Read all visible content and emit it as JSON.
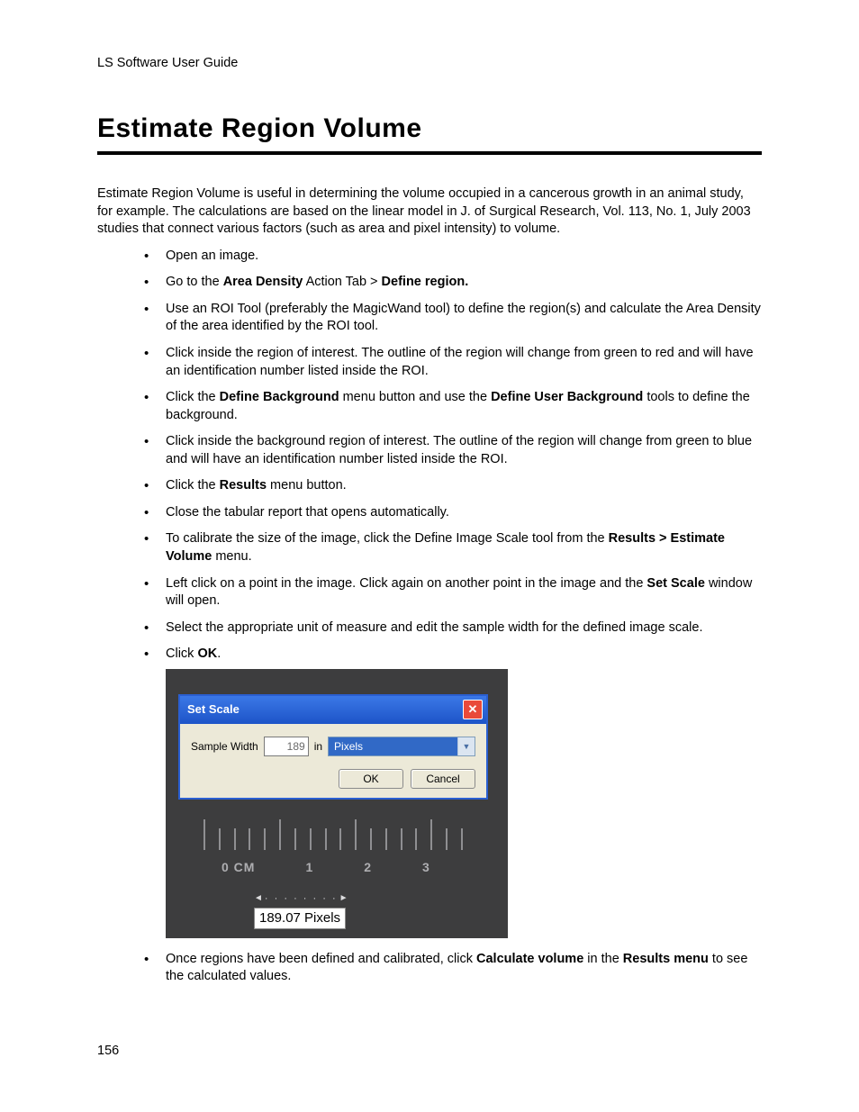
{
  "doc_header": "LS Software User Guide",
  "title": "Estimate Region Volume",
  "intro": "Estimate Region Volume is useful in determining the volume occupied in a cancerous growth in an animal study, for example.  The calculations are based on the linear model in J. of Surgical Research, Vol. 113, No. 1, July 2003 studies that connect various factors (such as area and pixel intensity) to volume.",
  "steps": {
    "s1": "Open an image.",
    "s2a": "Go to the ",
    "s2b": "Area Density",
    "s2c": " Action Tab > ",
    "s2d": "Define region.",
    "s3": "Use an ROI Tool (preferably the MagicWand tool)  to define the region(s) and calculate the Area Density of the area identified by the ROI tool.",
    "s4": "Click inside the region of interest. The outline of the region will change from green to red and will have an identification number listed inside the ROI.",
    "s5a": "Click the ",
    "s5b": "Define Background",
    "s5c": " menu button and use the ",
    "s5d": "Define User Background",
    "s5e": " tools to define the background.",
    "s6": "Click inside the background region of interest. The outline of the region will change from green to blue and will have an identification number listed inside the ROI.",
    "s7a": "Click the ",
    "s7b": "Results",
    "s7c": " menu button.",
    "s8": "Close the tabular report that opens automatically.",
    "s9a": "To calibrate the size of the image, click the Define Image Scale tool from the ",
    "s9b": "Results > Estimate Volume",
    "s9c": " menu.",
    "s10a": "Left click on a point in the image. Click again on another point in the image and the ",
    "s10b": "Set Scale",
    "s10c": " window will open.",
    "s11": "Select the appropriate unit of measure and edit the sample width for the defined image scale.",
    "s12a": "Click ",
    "s12b": "OK",
    "s12c": ".",
    "s13a": "Once regions have been defined and calibrated, click ",
    "s13b": "Calculate volume",
    "s13c": " in the ",
    "s13d": "Results menu",
    "s13e": " to see the calculated values."
  },
  "dialog": {
    "title": "Set Scale",
    "close_glyph": "✕",
    "sample_width_label": "Sample Width",
    "sample_width_value": "189",
    "in_label": "in",
    "unit_selected": "Pixels",
    "ok": "OK",
    "cancel": "Cancel"
  },
  "ruler": {
    "labels": [
      "0 CM",
      "1",
      "2",
      "3"
    ],
    "readout": "189.07 Pixels"
  },
  "page_number": "156"
}
